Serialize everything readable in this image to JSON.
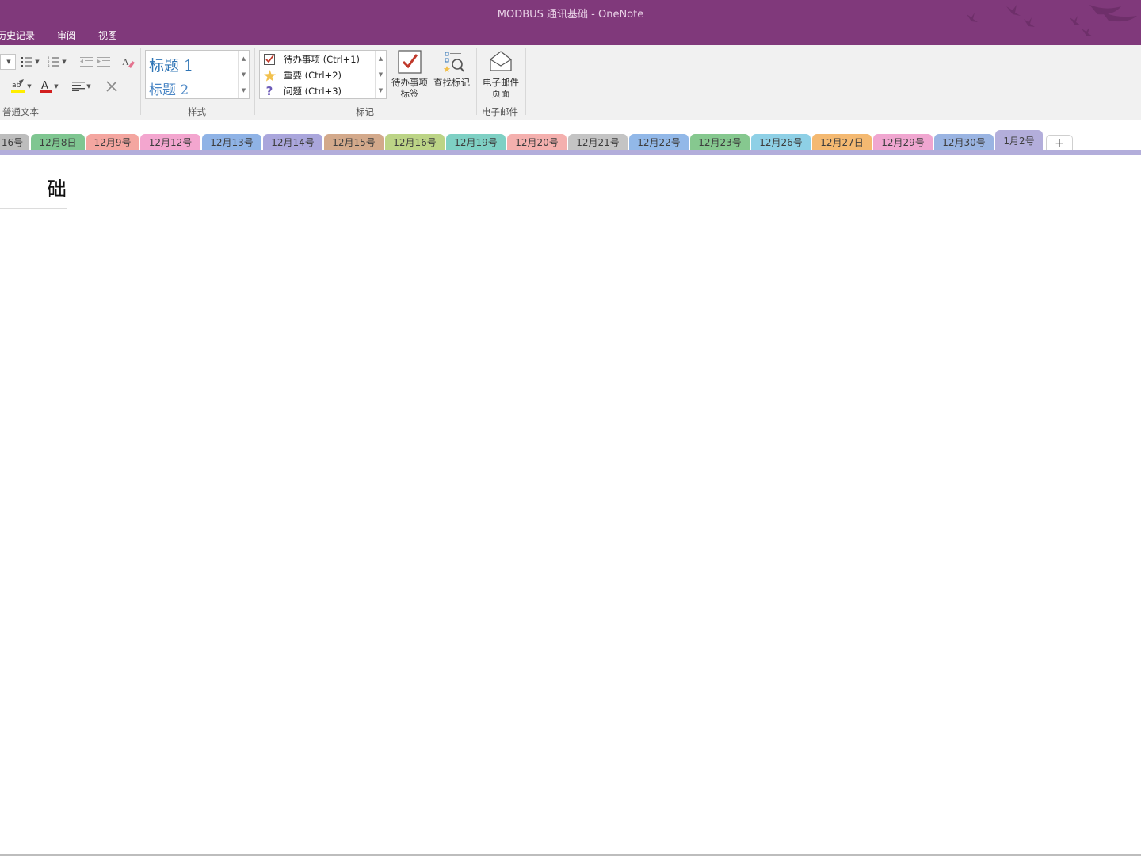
{
  "window": {
    "title": "MODBUS 通讯基础 - OneNote"
  },
  "menu": {
    "tabs": [
      {
        "label": "历史记录"
      },
      {
        "label": "审阅"
      },
      {
        "label": "视图"
      }
    ]
  },
  "ribbon": {
    "groups": {
      "basic_text": "普通文本",
      "styles": "样式",
      "tags": "标记",
      "email": "电子邮件"
    },
    "styles": {
      "heading1": "标题 1",
      "heading2": "标题 2"
    },
    "tags": [
      {
        "label": "待办事项 (Ctrl+1)",
        "icon": "checkbox-icon"
      },
      {
        "label": "重要 (Ctrl+2)",
        "icon": "star-icon"
      },
      {
        "label": "问题 (Ctrl+3)",
        "icon": "question-icon"
      }
    ],
    "todo_tag_button": "待办事项\n标签",
    "todo_tag_button_line1": "待办事项",
    "todo_tag_button_line2": "标签",
    "find_tags_button": "查找标记",
    "email_page_line1": "电子邮件",
    "email_page_line2": "页面"
  },
  "page_tabs": [
    {
      "label": "16号",
      "color": "#bdbdbd"
    },
    {
      "label": "12月8日",
      "color": "#7fc691"
    },
    {
      "label": "12月9号",
      "color": "#f4a6a0"
    },
    {
      "label": "12月12号",
      "color": "#f3a6cf"
    },
    {
      "label": "12月13号",
      "color": "#8fb3e6"
    },
    {
      "label": "12月14号",
      "color": "#aaa6dc"
    },
    {
      "label": "12月15号",
      "color": "#d3a98b"
    },
    {
      "label": "12月16号",
      "color": "#bcd486"
    },
    {
      "label": "12月19号",
      "color": "#7ed0c4"
    },
    {
      "label": "12月20号",
      "color": "#f4b0ae"
    },
    {
      "label": "12月21号",
      "color": "#c4c4c4"
    },
    {
      "label": "12月22号",
      "color": "#92b8e8"
    },
    {
      "label": "12月23号",
      "color": "#86c88f"
    },
    {
      "label": "12月26号",
      "color": "#8ed0e6"
    },
    {
      "label": "12月27日",
      "color": "#f4b971"
    },
    {
      "label": "12月29号",
      "color": "#f0a6d0"
    },
    {
      "label": "12月30号",
      "color": "#9ab4e2"
    },
    {
      "label": "1月2号",
      "color": "#b3aedb",
      "active": true
    }
  ],
  "add_tab_label": "+",
  "page": {
    "title_visible": "础"
  },
  "colors": {
    "accent": "#80397b",
    "ribbon_bg": "#f1f1f1",
    "active_section": "#b3aedb"
  }
}
